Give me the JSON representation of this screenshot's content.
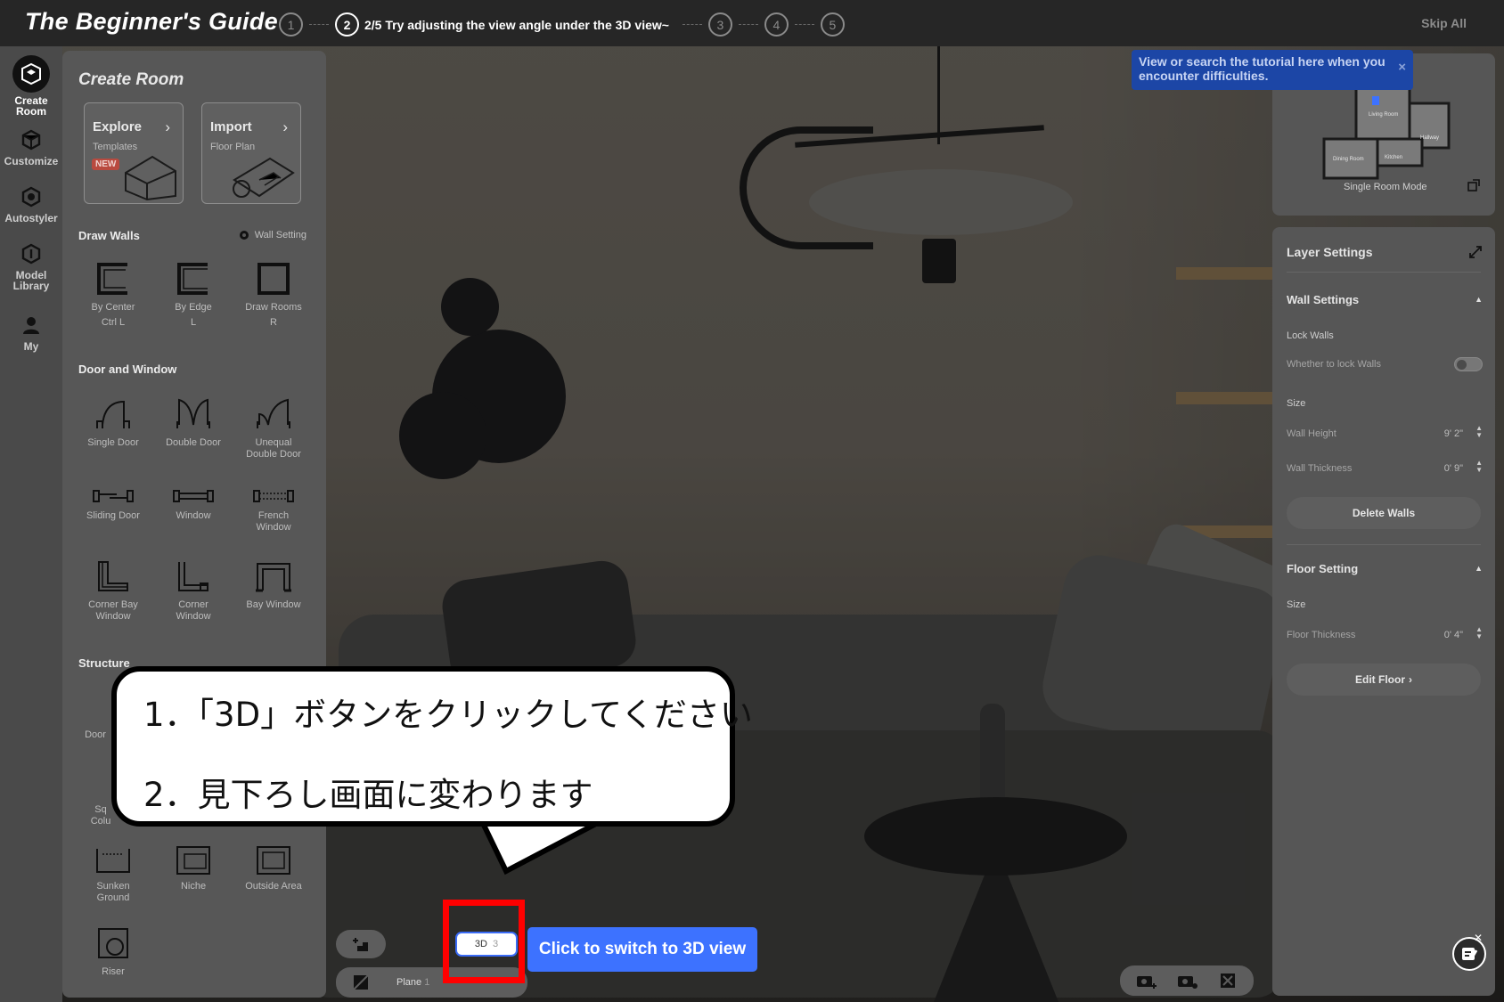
{
  "topbar": {
    "title": "The Beginner's Guide",
    "steps": [
      "1",
      "2",
      "3",
      "4",
      "5"
    ],
    "current_step_text": "2/5 Try adjusting the view angle under the 3D view~",
    "skip_label": "Skip All"
  },
  "rail": {
    "items": [
      {
        "label": "Create Room",
        "icon": "create-room-icon"
      },
      {
        "label": "Customize",
        "icon": "customize-icon"
      },
      {
        "label": "Autostyler",
        "icon": "autostyler-icon"
      },
      {
        "label": "Model Library",
        "icon": "model-library-icon"
      },
      {
        "label": "My",
        "icon": "user-icon"
      }
    ]
  },
  "panel": {
    "title": "Create Room",
    "cards": [
      {
        "title": "Explore",
        "subtitle": "Templates",
        "badge": "NEW"
      },
      {
        "title": "Import",
        "subtitle": "Floor Plan"
      }
    ],
    "draw_walls": {
      "heading": "Draw Walls",
      "setting_label": "Wall Setting",
      "tools": [
        {
          "label": "By Center",
          "shortcut": "Ctrl L"
        },
        {
          "label": "By Edge",
          "shortcut": "L"
        },
        {
          "label": "Draw Rooms",
          "shortcut": "R"
        }
      ]
    },
    "door_window": {
      "heading": "Door and Window",
      "tools": [
        {
          "label": "Single Door"
        },
        {
          "label": "Double Door"
        },
        {
          "label": "Unequal Double Door"
        },
        {
          "label": "Sliding Door"
        },
        {
          "label": "Window"
        },
        {
          "label": "French Window"
        },
        {
          "label": "Corner Bay Window"
        },
        {
          "label": "Corner Window"
        },
        {
          "label": "Bay Window"
        }
      ]
    },
    "structure": {
      "heading": "Structure",
      "partial_labels": [
        "Door",
        "Sq",
        "Colu"
      ],
      "tools": [
        {
          "label": "Sunken Ground"
        },
        {
          "label": "Niche"
        },
        {
          "label": "Outside Area"
        },
        {
          "label": "Riser"
        }
      ]
    }
  },
  "minimap": {
    "labels": [
      "Living Room",
      "Hallway",
      "Dining Room",
      "Kitchen"
    ],
    "mode_label": "Single Room Mode"
  },
  "tip": {
    "text": "View or search the tutorial here when you encounter difficulties.",
    "close": "×"
  },
  "layer": {
    "title": "Layer Settings",
    "wall": {
      "title": "Wall Settings",
      "lock_label": "Lock Walls",
      "lock_sub": "Whether to lock Walls",
      "size_label": "Size",
      "height_label": "Wall Height",
      "height_value": "9' 2\"",
      "thickness_label": "Wall Thickness",
      "thickness_value": "0' 9\"",
      "delete_label": "Delete Walls"
    },
    "floor": {
      "title": "Floor Setting",
      "size_label": "Size",
      "thickness_label": "Floor Thickness",
      "thickness_value": "0' 4\"",
      "edit_label": "Edit Floor"
    }
  },
  "bottom": {
    "view_3d_label": "3D",
    "view_3d_key": "3",
    "plane_label": "Plane",
    "plane_key": "1",
    "hint": "Click to switch to 3D view"
  },
  "callout": {
    "line1": "1．「3D」ボタンをクリックしてください",
    "line2": "2．見下ろし画面に変わります"
  },
  "colors": {
    "accent_blue": "#3d72ff",
    "highlight_red": "#ff0000",
    "tip_blue": "#1c46a6"
  }
}
